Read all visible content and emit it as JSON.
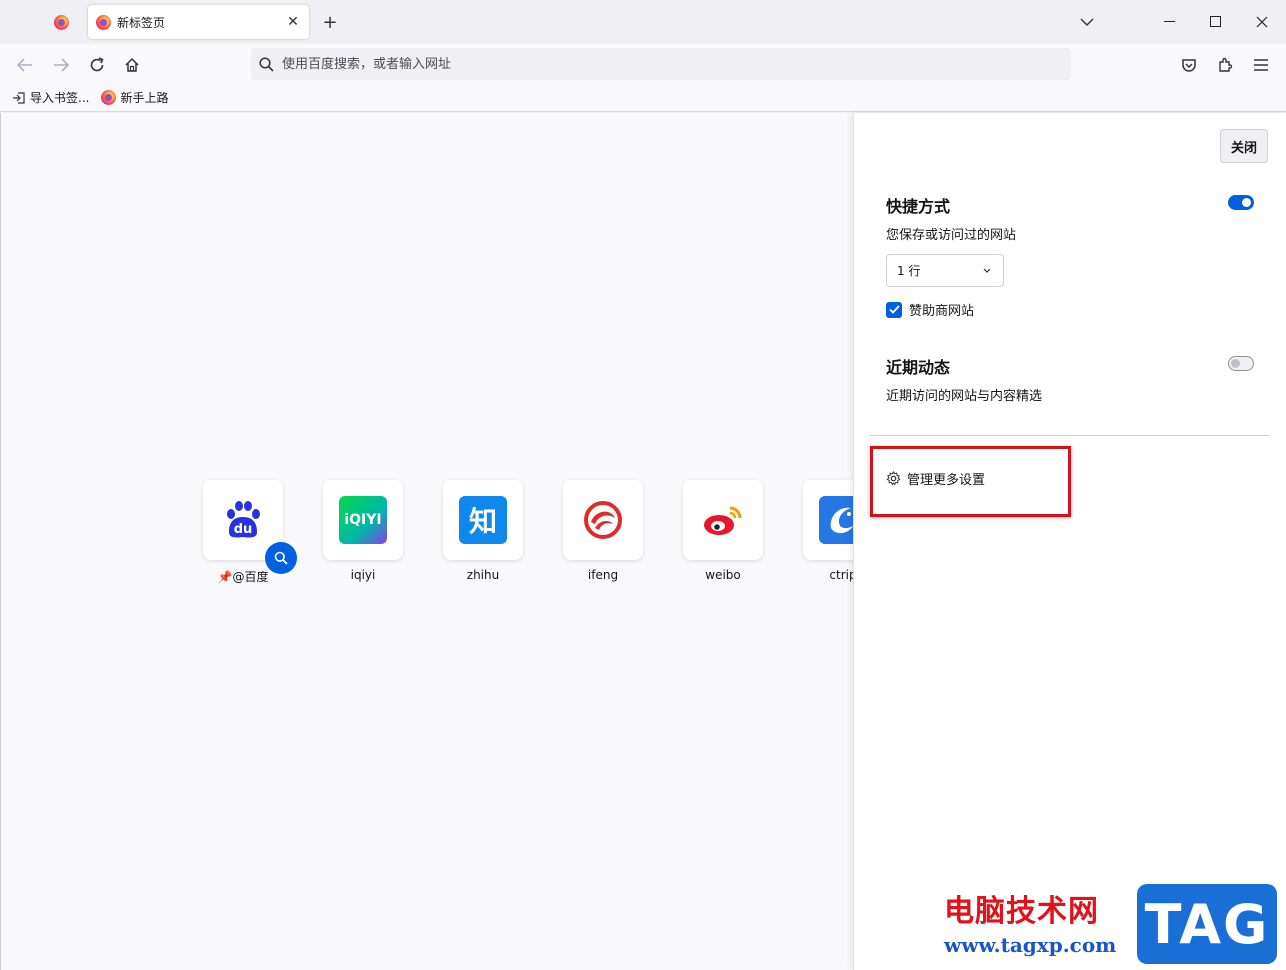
{
  "tabs": {
    "active_title": "新标签页",
    "new_tab_label": "+"
  },
  "navbar": {
    "url_placeholder": "使用百度搜索，或者输入网址"
  },
  "bookmarks": [
    {
      "label": "导入书签..."
    },
    {
      "label": "新手上路"
    }
  ],
  "tiles": [
    {
      "label": "@百度",
      "icon_text": "du",
      "color": "#2932e1"
    },
    {
      "label": "iqiyi",
      "icon_text": "iQIYI",
      "color": "#00be06"
    },
    {
      "label": "zhihu",
      "icon_text": "知",
      "color": "#0f88eb"
    },
    {
      "label": "ifeng",
      "icon_text": "",
      "color": "#e02b2b"
    },
    {
      "label": "weibo",
      "icon_text": "",
      "color": "#e6162d"
    },
    {
      "label": "ctrip",
      "icon_text": "",
      "color": "#2577e3"
    }
  ],
  "panel": {
    "close_label": "关闭",
    "shortcuts": {
      "title": "快捷方式",
      "desc": "您保存或访问过的网站",
      "enabled": true,
      "rows_value": "1 行",
      "sponsored_label": "赞助商网站",
      "sponsored_checked": true
    },
    "recent": {
      "title": "近期动态",
      "desc": "近期访问的网站与内容精选",
      "enabled": false
    },
    "manage_label": "管理更多设置"
  },
  "watermark": {
    "text": "电脑技术网",
    "url": "www.tagxp.com",
    "badge": "TAG"
  },
  "colors": {
    "accent": "#0060df",
    "highlight": "#d1141b"
  }
}
